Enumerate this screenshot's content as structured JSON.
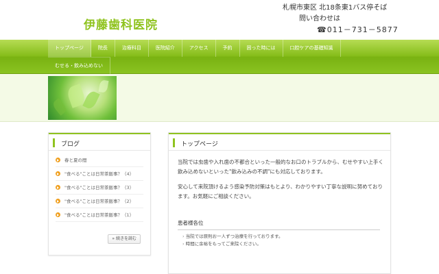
{
  "header": {
    "site_title": "伊藤歯科医院",
    "address": "札幌市東区 北18条東1バス停そば",
    "contact_label": "問い合わせは",
    "tel": "☎011－731－5877"
  },
  "nav": {
    "row1": [
      "トップページ",
      "院長",
      "治療科目",
      "医院紹介",
      "アクセス",
      "予約",
      "困った時には",
      "口腔ケアの基礎知識"
    ],
    "row2": [
      "むせる・飲み込めない"
    ],
    "active_index": 0
  },
  "sidebar": {
    "title": "ブログ",
    "items": [
      "春と夏の間",
      "\"食べる\"ことは日常茶飯事？（4）",
      "\"食べる\"ことは日常茶飯事？（3）",
      "\"食べる\"ことは日常茶飯事？（2）",
      "\"食べる\"ことは日常茶飯事？（1）"
    ],
    "more_label": "» 続きを読む"
  },
  "main": {
    "title": "トップページ",
    "paragraph1": "当院では虫歯や入れ歯の不都合といった一般的なお口のトラブルから、むせやすい上手く飲み込めないといった\"飲み込みの不調\"にも対応しております。",
    "paragraph2": "安心して来院頂けるよう感染予防対策はもとより、わかりやすい丁寧な説明に努めております。お気軽にご相談ください。",
    "subheading": "患者様各位",
    "notices": [
      "当院では原則お一人ずつ治療を行っております。",
      "時間に余裕をもってご来院ください。"
    ]
  },
  "colors": {
    "brand_green": "#8fc31f",
    "bullet_orange": "#f0a020"
  }
}
